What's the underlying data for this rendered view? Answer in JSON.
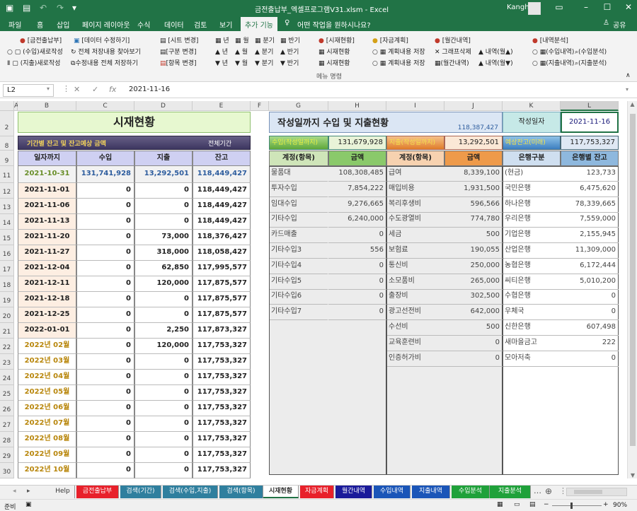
{
  "window": {
    "title": "금전출납부_엑셀프로그램V31.xlsm  -  Excel",
    "user": "Kangha"
  },
  "menu": {
    "tabs": [
      "파일",
      "홈",
      "삽입",
      "페이지 레이아웃",
      "수식",
      "데이터",
      "검토",
      "보기",
      "추가 기능"
    ],
    "tell_me": "어떤 작업을 원하시나요?",
    "share": "공유"
  },
  "ribbon": {
    "headers": {
      "h1": "[금전출납부]",
      "h2": "[데이터 수정하기]",
      "h3": "[시트 변경]",
      "h4": "년",
      "h5": "월",
      "h6": "분기",
      "h7": "반기",
      "h8": "[시재현황]",
      "h9": "[자금계획]",
      "h10": "[월간내역]",
      "h11": "[내역분석]"
    },
    "row1": {
      "a": "(수입)새로작성",
      "b": "전체 저장내용 찾아보기",
      "c": "[구분 변경]",
      "d": "년",
      "e": "월",
      "f": "분기",
      "g": "반기",
      "h": "시재현황",
      "i": "계획내용 저장",
      "j": "그래프삭제",
      "k": "내역(월▲)",
      "l": "(수입내역)",
      "m": "(수입분석)"
    },
    "row2": {
      "a": "(지출)새로작성",
      "b": "수정내용 전체 저장하기",
      "c": "[항목 변경]",
      "d": "년",
      "e": "월",
      "f": "분기",
      "g": "반기",
      "h": "시재현황",
      "i": "계획내용 저장",
      "j": "(월간내역)",
      "k": "내역(월▼)",
      "l": "(지출내역)",
      "m": "(지출분석)"
    },
    "footer": "메뉴 명령"
  },
  "formula_bar": {
    "name_box": "L2",
    "value": "2021-11-16"
  },
  "columns": [
    "A",
    "B",
    "C",
    "D",
    "E",
    "F",
    "G",
    "H",
    "I",
    "J",
    "K",
    "L"
  ],
  "rows": [
    "2",
    "8",
    "9",
    "11",
    "12",
    "13",
    "14",
    "15",
    "16",
    "17",
    "18",
    "19",
    "20",
    "21",
    "22",
    "23",
    "24",
    "25",
    "26",
    "27",
    "28",
    "29",
    "30"
  ],
  "left": {
    "title": "시재현황",
    "band_label": "기간별 잔고 및 잔고예상 금액",
    "band_right": "전체기간",
    "headers": [
      "일자까지",
      "수입",
      "지출",
      "잔고"
    ],
    "rows": [
      [
        "2021-10-31",
        "131,741,928",
        "13,292,501",
        "118,449,427"
      ],
      [
        "2021-11-01",
        "0",
        "0",
        "118,449,427"
      ],
      [
        "2021-11-06",
        "0",
        "0",
        "118,449,427"
      ],
      [
        "2021-11-13",
        "0",
        "0",
        "118,449,427"
      ],
      [
        "2021-11-20",
        "0",
        "73,000",
        "118,376,427"
      ],
      [
        "2021-11-27",
        "0",
        "318,000",
        "118,058,427"
      ],
      [
        "2021-12-04",
        "0",
        "62,850",
        "117,995,577"
      ],
      [
        "2021-12-11",
        "0",
        "120,000",
        "117,875,577"
      ],
      [
        "2021-12-18",
        "0",
        "0",
        "117,875,577"
      ],
      [
        "2021-12-25",
        "0",
        "0",
        "117,875,577"
      ],
      [
        "2022-01-01",
        "0",
        "2,250",
        "117,873,327"
      ],
      [
        "2022년 02월",
        "0",
        "120,000",
        "117,753,327"
      ],
      [
        "2022년 03월",
        "0",
        "0",
        "117,753,327"
      ],
      [
        "2022년 04월",
        "0",
        "0",
        "117,753,327"
      ],
      [
        "2022년 05월",
        "0",
        "0",
        "117,753,327"
      ],
      [
        "2022년 06월",
        "0",
        "0",
        "117,753,327"
      ],
      [
        "2022년 07월",
        "0",
        "0",
        "117,753,327"
      ],
      [
        "2022년 08월",
        "0",
        "0",
        "117,753,327"
      ],
      [
        "2022년 09월",
        "0",
        "0",
        "117,753,327"
      ],
      [
        "2022년 10월",
        "0",
        "0",
        "117,753,327"
      ]
    ]
  },
  "right": {
    "title": "작성일까지 수입 및 지출현황",
    "title_total": "118,387,427",
    "date_label": "작성일자",
    "date_value": "2021-11-16",
    "summary": {
      "income_label": "수입(작성일까지)",
      "income": "131,679,928",
      "expense_label": "지출(작성일까지)",
      "expense": "13,292,501",
      "forecast_label": "예상잔고(미래)",
      "forecast": "117,753,327"
    },
    "headers": [
      "계정(항목)",
      "금액",
      "계정(항목)",
      "금액",
      "은행구분",
      "은행별 잔고"
    ],
    "income": [
      [
        "물품대",
        "108,308,485"
      ],
      [
        "투자수입",
        "7,854,222"
      ],
      [
        "임대수입",
        "9,276,665"
      ],
      [
        "기타수입",
        "6,240,000"
      ],
      [
        "카드매출",
        "0"
      ],
      [
        "기타수입3",
        "556"
      ],
      [
        "기타수입4",
        "0"
      ],
      [
        "기타수입5",
        "0"
      ],
      [
        "기타수입6",
        "0"
      ],
      [
        "기타수입7",
        "0"
      ]
    ],
    "expense": [
      [
        "급여",
        "8,339,100"
      ],
      [
        "매입비용",
        "1,931,500"
      ],
      [
        "복리후생비",
        "596,566"
      ],
      [
        "수도광열비",
        "774,780"
      ],
      [
        "세금",
        "500"
      ],
      [
        "보험료",
        "190,055"
      ],
      [
        "통신비",
        "250,000"
      ],
      [
        "소모품비",
        "265,000"
      ],
      [
        "출장비",
        "302,500"
      ],
      [
        "광고선전비",
        "642,000"
      ],
      [
        "수선비",
        "500"
      ],
      [
        "교육훈련비",
        "0"
      ],
      [
        "인증허가비",
        "0"
      ]
    ],
    "banks": [
      [
        "(현금)",
        "123,733"
      ],
      [
        "국민은행",
        "6,475,620"
      ],
      [
        "하나은행",
        "78,339,665"
      ],
      [
        "우리은행",
        "7,559,000"
      ],
      [
        "기업은행",
        "2,155,945"
      ],
      [
        "산업은행",
        "11,309,000"
      ],
      [
        "농협은행",
        "6,172,444"
      ],
      [
        "씨티은행",
        "5,010,200"
      ],
      [
        "수협은행",
        "0"
      ],
      [
        "우체국",
        "0"
      ],
      [
        "신한은행",
        "607,498"
      ],
      [
        "새마을금고",
        "222"
      ],
      [
        "모아저축",
        "0"
      ]
    ]
  },
  "sheet_tabs": [
    {
      "label": "Help",
      "color": "#f0f0f0"
    },
    {
      "label": "금전출납부",
      "color": "#e8202a"
    },
    {
      "label": "검색(기간)",
      "color": "#2f7f9e"
    },
    {
      "label": "검색(수입,지출)",
      "color": "#2f7f9e"
    },
    {
      "label": "검색(항목)",
      "color": "#2f7f9e"
    },
    {
      "label": "시재현황",
      "color": "#ffffff"
    },
    {
      "label": "자금계획",
      "color": "#e8202a"
    },
    {
      "label": "월간내역",
      "color": "#1a1a9a"
    },
    {
      "label": "수입내역",
      "color": "#1a55b8"
    },
    {
      "label": "지출내역",
      "color": "#1a55b8"
    },
    {
      "label": "수입분석",
      "color": "#1fa13a"
    },
    {
      "label": "지출분석",
      "color": "#1fa13a"
    }
  ],
  "status": {
    "ready": "준비",
    "zoom": "90%"
  }
}
